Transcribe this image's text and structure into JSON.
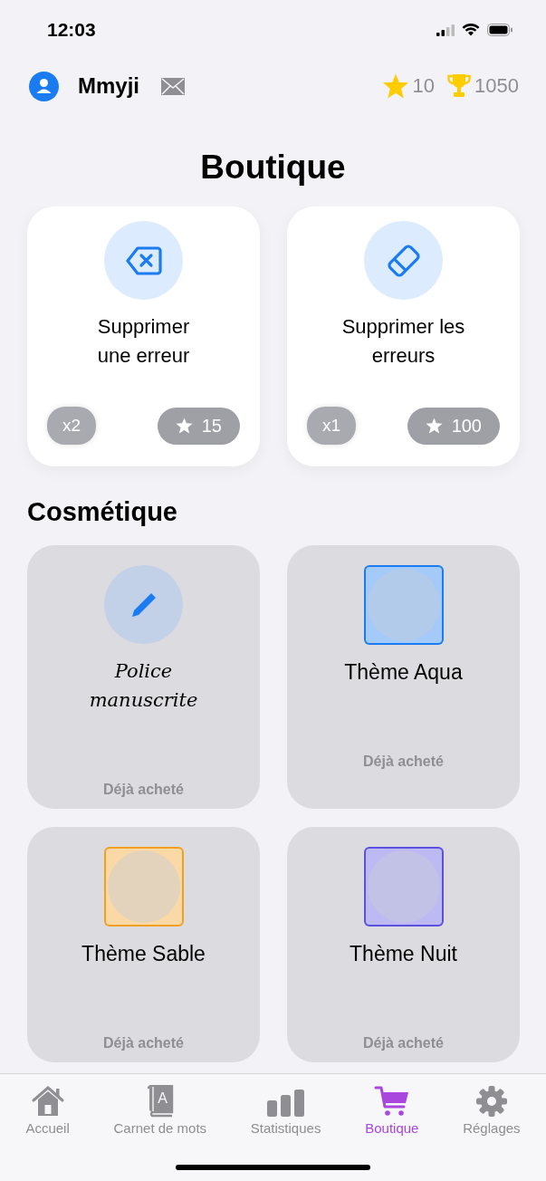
{
  "status_bar": {
    "time": "12:03"
  },
  "header": {
    "username": "Mmyji",
    "stars": "10",
    "trophies": "1050"
  },
  "title": "Boutique",
  "powerups": [
    {
      "kind": "backspace",
      "label": "Supprimer une erreur",
      "quantity": "x2",
      "price": "15",
      "affordable": false
    },
    {
      "kind": "eraser",
      "label": "Supprimer les erreurs",
      "quantity": "x1",
      "price": "100",
      "affordable": false
    }
  ],
  "cosmetics": {
    "heading": "Cosmétique",
    "items": [
      {
        "kind": "font",
        "label": "Police manuscrite",
        "owned": true,
        "status": "Déjà acheté"
      },
      {
        "kind": "theme",
        "label": "Thème Aqua",
        "color": "#1a7cf0",
        "owned": true,
        "status": "Déjà acheté"
      },
      {
        "kind": "theme",
        "label": "Thème Sable",
        "color": "#f2a022",
        "owned": true,
        "status": "Déjà acheté"
      },
      {
        "kind": "theme",
        "label": "Thème Nuit",
        "color": "#5b50e0",
        "owned": true,
        "status": "Déjà acheté"
      }
    ]
  },
  "tabs": [
    {
      "label": "Accueil",
      "selected": false
    },
    {
      "icon_letter": "A",
      "label": "Carnet de mots",
      "selected": false
    },
    {
      "label": "Statistiques",
      "selected": false
    },
    {
      "label": "Boutique",
      "selected": true
    },
    {
      "label": "Réglages",
      "selected": false
    }
  ]
}
